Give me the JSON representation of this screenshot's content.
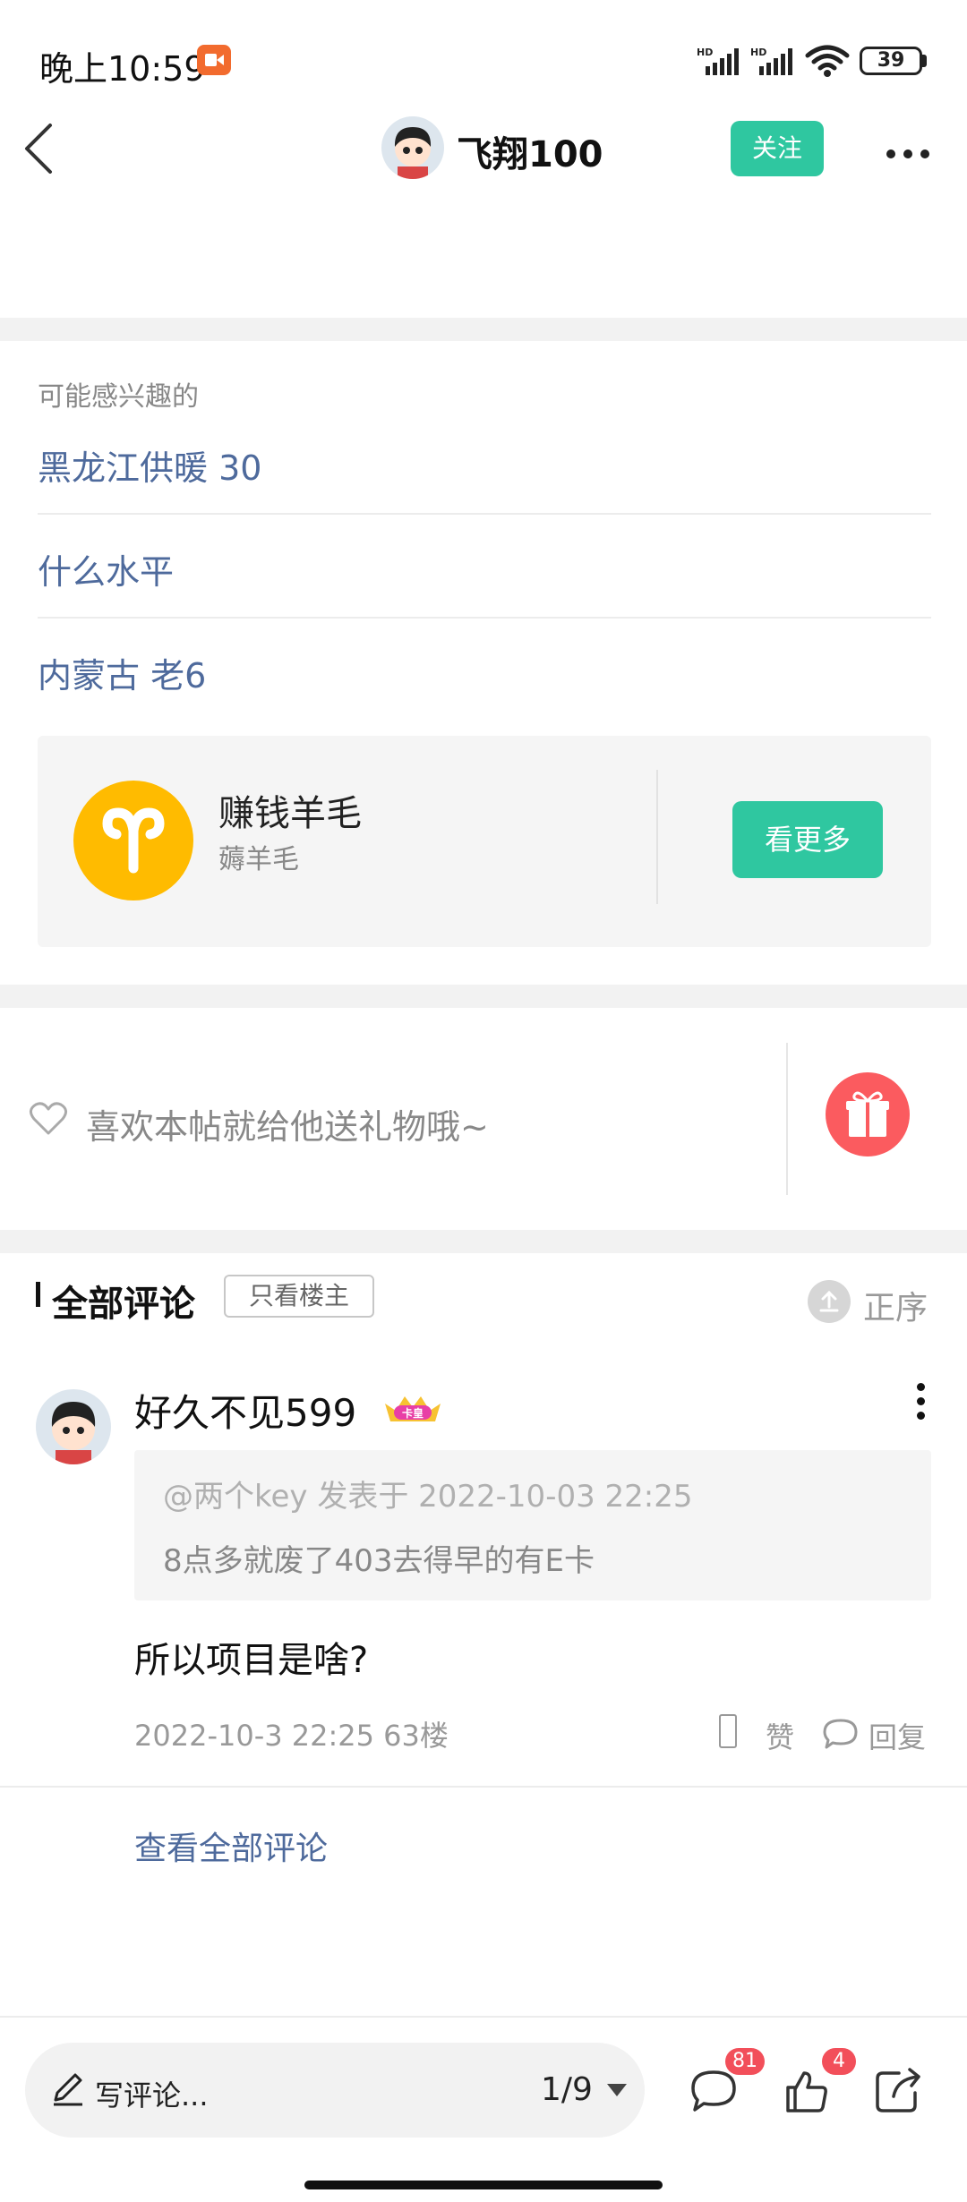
{
  "status_bar": {
    "time": "晚上10:59",
    "battery": "39",
    "network_labels": [
      "HD",
      "HD"
    ]
  },
  "header": {
    "title": "飞翔100",
    "follow_label": "关注"
  },
  "interests": {
    "caption": "可能感兴趣的",
    "items": [
      "黑龙江供暖 30",
      "什么水平",
      "内蒙古 老6"
    ]
  },
  "circle_card": {
    "title": "赚钱羊毛",
    "subtitle": "薅羊毛",
    "button_label": "看更多"
  },
  "gift": {
    "text": "喜欢本帖就给他送礼物哦~"
  },
  "comments": {
    "title": "全部评论",
    "op_only_label": "只看楼主",
    "sort_label": "正序",
    "view_all_label": "查看全部评论",
    "items": [
      {
        "user": "好久不见599",
        "badge_label": "卡皇",
        "quote_meta": "@两个key 发表于 2022-10-03 22:25",
        "quote_text": "8点多就废了403去得早的有E卡",
        "body": "所以项目是啥?",
        "meta": "2022-10-3 22:25  63楼",
        "like_label": "赞",
        "reply_label": "回复"
      }
    ]
  },
  "bottom_bar": {
    "input_placeholder": "写评论...",
    "page_indicator": "1/9",
    "comment_count": "81",
    "like_count": "4"
  },
  "colors": {
    "accent": "#2fc7a0",
    "link": "#4e6a9c",
    "badge": "#f24f5a",
    "gift": "#fb5b5f",
    "circle_icon": "#ffbb00"
  }
}
